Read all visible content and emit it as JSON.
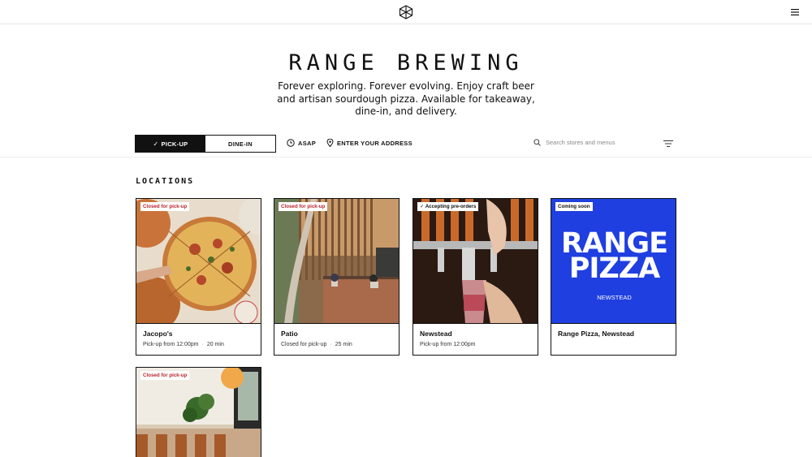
{
  "header": {
    "logo_icon": "range-cube-logo-icon",
    "menu_icon": "hamburger-icon"
  },
  "hero": {
    "brand": "RANGE BREWING",
    "tagline": "Forever exploring. Forever evolving. Enjoy craft beer and artisan sourdough pizza. Available for takeaway, dine-in, and delivery."
  },
  "controls": {
    "pickup_label": "PICK-UP",
    "dinein_label": "DINE-IN",
    "asap_label": "ASAP",
    "address_label": "ENTER YOUR ADDRESS",
    "search_placeholder": "Search stores and menus"
  },
  "locations": {
    "title": "LOCATIONS",
    "cards": [
      {
        "badge": "Closed for pick-up",
        "name": "Jacopo's",
        "status": "Pick-up from 12:00pm",
        "time": "20 min"
      },
      {
        "badge": "Closed for pick-up",
        "name": "Patio",
        "status": "Closed for pick-up",
        "time": "25 min"
      },
      {
        "badge": "Accepting pre-orders",
        "name": "Newstead",
        "status": "Pick-up from 12:00pm",
        "time": ""
      },
      {
        "badge": "Coming soon",
        "name": "Range Pizza, Newstead",
        "status": "",
        "time": "",
        "logo_line1": "RANGE",
        "logo_line2": "PIZZA",
        "logo_sub": "NEWSTEAD"
      },
      {
        "badge": "Closed for pick-up"
      }
    ]
  },
  "colors": {
    "accent": "#111111",
    "closed_badge": "#b8252e",
    "range_pizza_blue": "#1f3fe0"
  }
}
